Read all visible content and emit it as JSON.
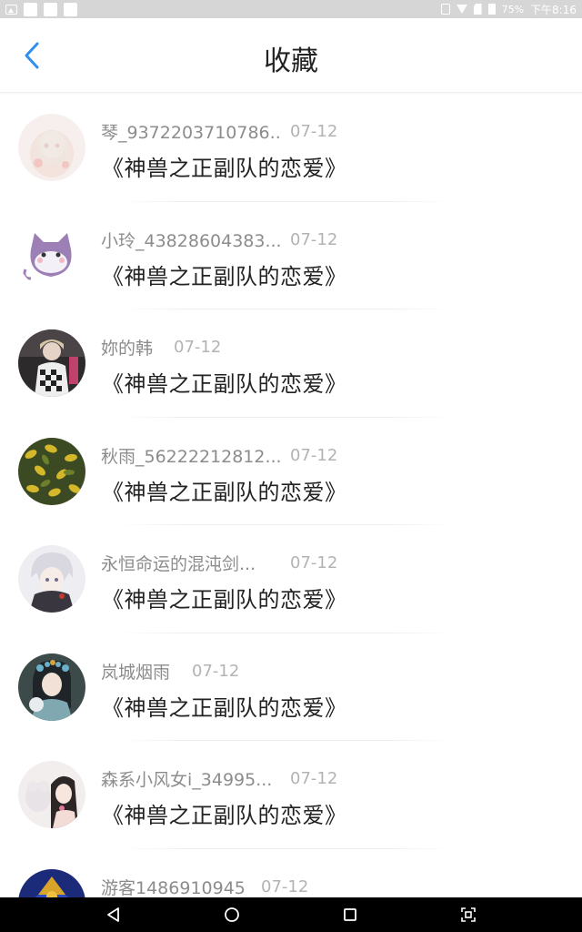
{
  "status_bar": {
    "battery": "75%",
    "time": "下午8:16",
    "left_icons": [
      "image-icon",
      "square-icon",
      "square-icon",
      "square-icon"
    ],
    "right_icons": [
      "vibrate-icon",
      "wifi-icon",
      "sim-icon",
      "battery-icon"
    ]
  },
  "header": {
    "title": "收藏",
    "back_icon": "chevron-left-icon",
    "accent_color": "#2f8ff0"
  },
  "list": {
    "items": [
      {
        "nickname": "琴_9372203710786..",
        "date": "07-12",
        "book": "《神兽之正副队的恋爱》",
        "avatar": "anime-girl-pink"
      },
      {
        "nickname": "小玲_43828604383...",
        "date": "07-12",
        "book": "《神兽之正副队的恋爱》",
        "avatar": "purple-cat"
      },
      {
        "nickname": "妳的韩",
        "date": "07-12",
        "book": "《神兽之正副队的恋爱》",
        "avatar": "person-checkered"
      },
      {
        "nickname": "秋雨_56222212812...",
        "date": "07-12",
        "book": "《神兽之正副队的恋爱》",
        "avatar": "yellow-leaves"
      },
      {
        "nickname": "永恒命运的混沌剑...",
        "date": "07-12",
        "book": "《神兽之正副队的恋爱》",
        "avatar": "anime-boy-silver"
      },
      {
        "nickname": "岚城烟雨",
        "date": "07-12",
        "book": "《神兽之正副队的恋爱》",
        "avatar": "hanfu-girl"
      },
      {
        "nickname": "森系小风女i_34995...",
        "date": "07-12",
        "book": "《神兽之正副队的恋爱》",
        "avatar": "girl-with-plush"
      },
      {
        "nickname": "游客1486910945",
        "date": "07-12",
        "book": "",
        "avatar": "blue-gold-art"
      }
    ]
  },
  "nav_bar": {
    "buttons": [
      "back-triangle-icon",
      "home-circle-icon",
      "recents-square-icon",
      "screenshot-icon"
    ]
  }
}
